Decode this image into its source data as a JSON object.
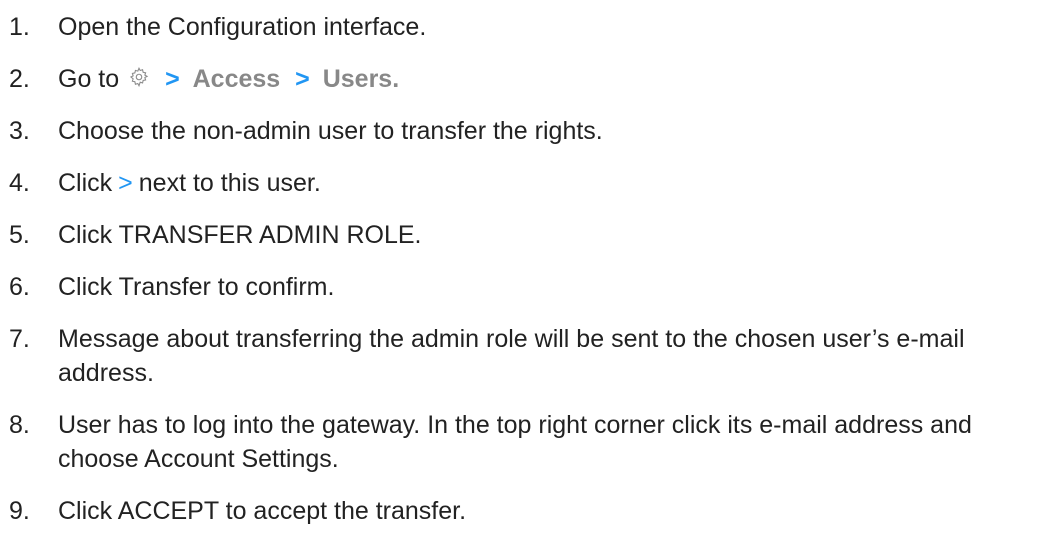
{
  "steps": [
    {
      "num": "1.",
      "text": "Open the Configuration interface."
    },
    {
      "num": "2.",
      "prefix": "Go to",
      "icon": "gear-icon",
      "sep1": ">",
      "item1": "Access",
      "sep2": ">",
      "item2": "Users."
    },
    {
      "num": "3.",
      "text": "Choose the non-admin user to transfer the rights."
    },
    {
      "num": "4.",
      "prefix": "Click",
      "icon": "chevron-right-icon",
      "chevron": ">",
      "suffix": "next to this user."
    },
    {
      "num": "5.",
      "text": "Click TRANSFER ADMIN ROLE."
    },
    {
      "num": "6.",
      "text": "Click Transfer to confirm."
    },
    {
      "num": "7.",
      "text": "Message about transferring the admin role will be sent to the chosen user’s e-mail address."
    },
    {
      "num": "8.",
      "text": "User has to log into the gateway. In the top right corner click its e-mail address and choose Account Settings."
    },
    {
      "num": "9.",
      "text": "Click ACCEPT to accept the transfer."
    }
  ],
  "colors": {
    "accent": "#2196f3",
    "muted_path": "#888888",
    "text": "#222222",
    "background": "#ffffff"
  }
}
